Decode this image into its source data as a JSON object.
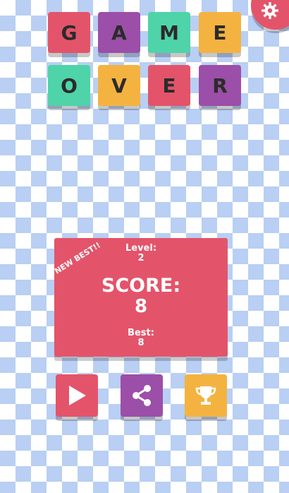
{
  "title_tiles": [
    {
      "letter": "G",
      "color": "#e3546a"
    },
    {
      "letter": "A",
      "color": "#9b4fa8"
    },
    {
      "letter": "M",
      "color": "#4fd3a8"
    },
    {
      "letter": "E",
      "color": "#f4b340"
    },
    {
      "letter": "O",
      "color": "#4fd3a8"
    },
    {
      "letter": "V",
      "color": "#f4b340"
    },
    {
      "letter": "E",
      "color": "#e3546a"
    },
    {
      "letter": "R",
      "color": "#9b4fa8"
    }
  ],
  "results": {
    "badge": "NEW BEST!!",
    "level_label": "Level:",
    "level_value": "2",
    "score_label": "SCORE:",
    "score_value": "8",
    "best_label": "Best:",
    "best_value": "8"
  },
  "buttons": {
    "play": {
      "icon": "play-icon",
      "color": "#e3546a"
    },
    "share": {
      "icon": "share-icon",
      "color": "#9b4fa8"
    },
    "leaderboard": {
      "icon": "trophy-icon",
      "color": "#f4b340"
    }
  },
  "settings": {
    "icon": "gear-icon",
    "color": "#e3546a"
  }
}
